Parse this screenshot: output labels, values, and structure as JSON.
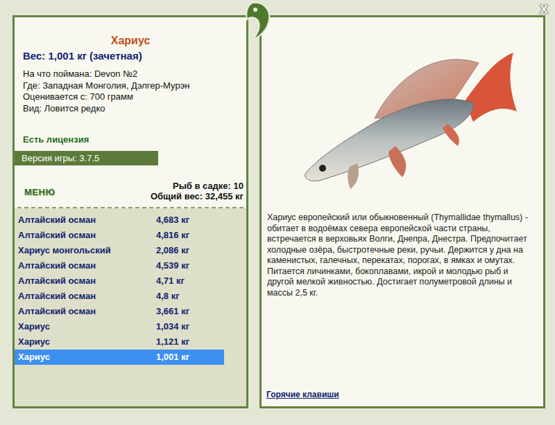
{
  "window": {
    "close": "X"
  },
  "fish": {
    "name": "Хариус",
    "weight": "Вес: 1,001 кг (зачетная)",
    "details": [
      "На что поймана: Devon №2",
      "Где: Западная Монголия, Дэлгер-Мурэн",
      "Оценивается с: 700 грамм",
      "Вид: Ловится редко"
    ],
    "license": "Есть лицензия",
    "version": "Версия игры: 3.7.5"
  },
  "menu": "МЕНЮ",
  "keepnet": {
    "count": "Рыб в садке: 10",
    "total": "Общий вес: 32,455 кг"
  },
  "catch": [
    {
      "name": "Алтайский осман",
      "weight": "4,683 кг",
      "selected": false
    },
    {
      "name": "Алтайский осман",
      "weight": "4,816 кг",
      "selected": false
    },
    {
      "name": "Хариус монгольский",
      "weight": "2,086 кг",
      "selected": false
    },
    {
      "name": "Алтайский осман",
      "weight": "4,539 кг",
      "selected": false
    },
    {
      "name": "Алтайский осман",
      "weight": "4,71 кг",
      "selected": false
    },
    {
      "name": "Алтайский осман",
      "weight": "4,8 кг",
      "selected": false
    },
    {
      "name": "Алтайский осман",
      "weight": "3,661 кг",
      "selected": false
    },
    {
      "name": "Хариус",
      "weight": "1,034 кг",
      "selected": false
    },
    {
      "name": "Хариус",
      "weight": "1,121 кг",
      "selected": false
    },
    {
      "name": "Хариус",
      "weight": "1,001 кг",
      "selected": true
    }
  ],
  "description": "Хариус европейский или обыкновенный (Thymallidae thymallus) - обитает в водоёмах севера европейской части страны, встречается в верховьях Волги, Днепра, Днестра. Предпочитает холодные озёра, быстротечные реки, ручьи. Держится у дна на каменистых, галечных, перекатах, порогах, в ямках и омутах. Питается личинками, бокоплавами, икрой и молодью рыб и другой мелкой живностью. Достигает полуметровой длины и массы 2,5 кг.",
  "hotkeys": "Горячие клавиши"
}
